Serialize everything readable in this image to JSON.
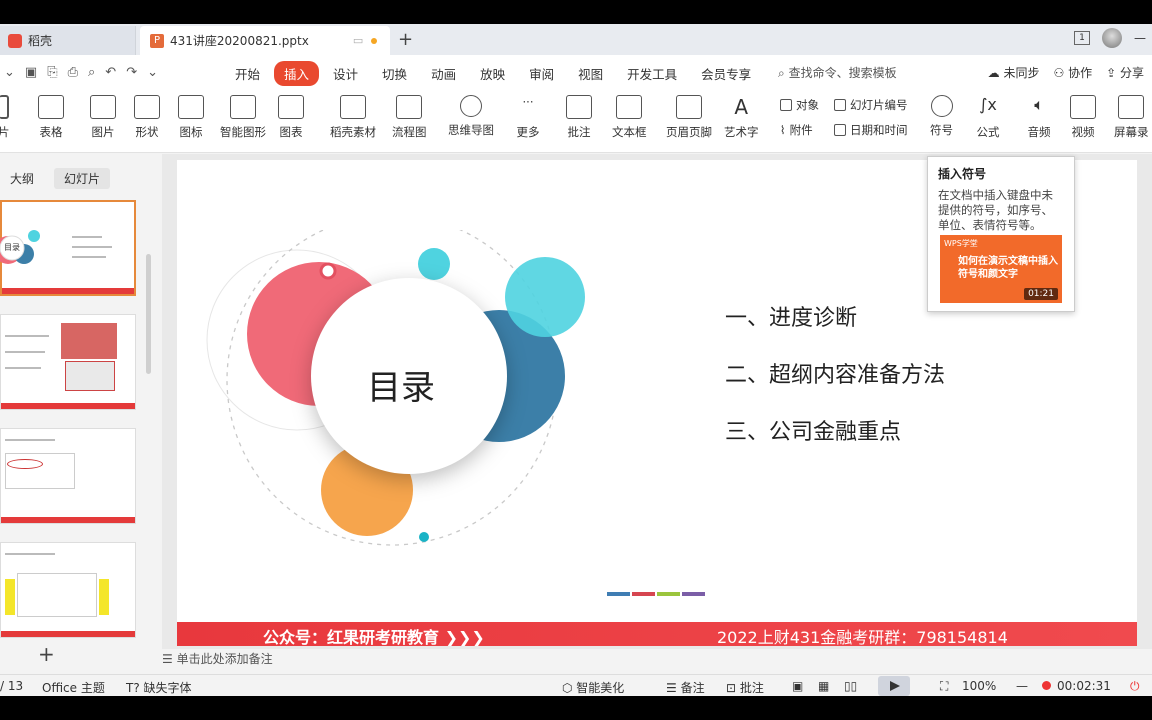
{
  "tabs": {
    "home_label": "稻壳",
    "file_label": "431讲座20200821.pptx"
  },
  "menu": {
    "items": [
      "开始",
      "插入",
      "设计",
      "切换",
      "动画",
      "放映",
      "审阅",
      "视图",
      "开发工具",
      "会员专享"
    ],
    "active": "插入",
    "search_placeholder": "查找命令、搜索模板",
    "sync": "未同步",
    "collab": "协作",
    "share": "分享"
  },
  "ribbon": {
    "items": [
      "片",
      "表格",
      "图片",
      "形状",
      "图标",
      "智能图形",
      "图表",
      "稻壳素材",
      "流程图",
      "思维导图",
      "更多",
      "批注",
      "文本框",
      "页眉页脚",
      "艺术字"
    ],
    "object": "对象",
    "attachment": "附件",
    "slide_number": "幻灯片编号",
    "datetime": "日期和时间",
    "symbol": "符号",
    "formula": "公式",
    "audio": "音频",
    "video": "视频",
    "screen_record": "屏幕录"
  },
  "left_panel": {
    "outline_tab": "大纲",
    "slides_tab": "幻灯片",
    "thumb_title": "目录"
  },
  "slide": {
    "center_title": "目录",
    "toc": [
      "一、进度诊断",
      "二、超纲内容准备方法",
      "三、公司金融重点"
    ],
    "banner_left": "公众号：红果研考研教育 ❯❯❯",
    "banner_right": "2022上财431金融考研群：798154814",
    "bar_colors": [
      "#3f7db3",
      "#d64550",
      "#9bc53d",
      "#7b5ea7"
    ]
  },
  "notes_placeholder": "单击此处添加备注",
  "tooltip": {
    "title": "插入符号",
    "description": "在文档中插入键盘中未提供的符号，如序号、单位、表情符号等。",
    "video_logo": "WPS学堂",
    "video_title": "如何在演示文稿中插入符号和颜文字",
    "video_duration": "01:21"
  },
  "statusbar": {
    "page": "/ 13",
    "theme": "Office 主题",
    "missing_font": "缺失字体",
    "beautify": "智能美化",
    "notes": "备注",
    "comments": "批注",
    "zoom": "100%",
    "timer": "00:02:31"
  },
  "colors": {
    "accent": "#e9492f",
    "banner": "#e8383d",
    "circle_pink": "#f06a78",
    "circle_blue": "#3c7fa8",
    "circle_cyan": "#4fd3e0",
    "circle_orange": "#f6a54d"
  }
}
